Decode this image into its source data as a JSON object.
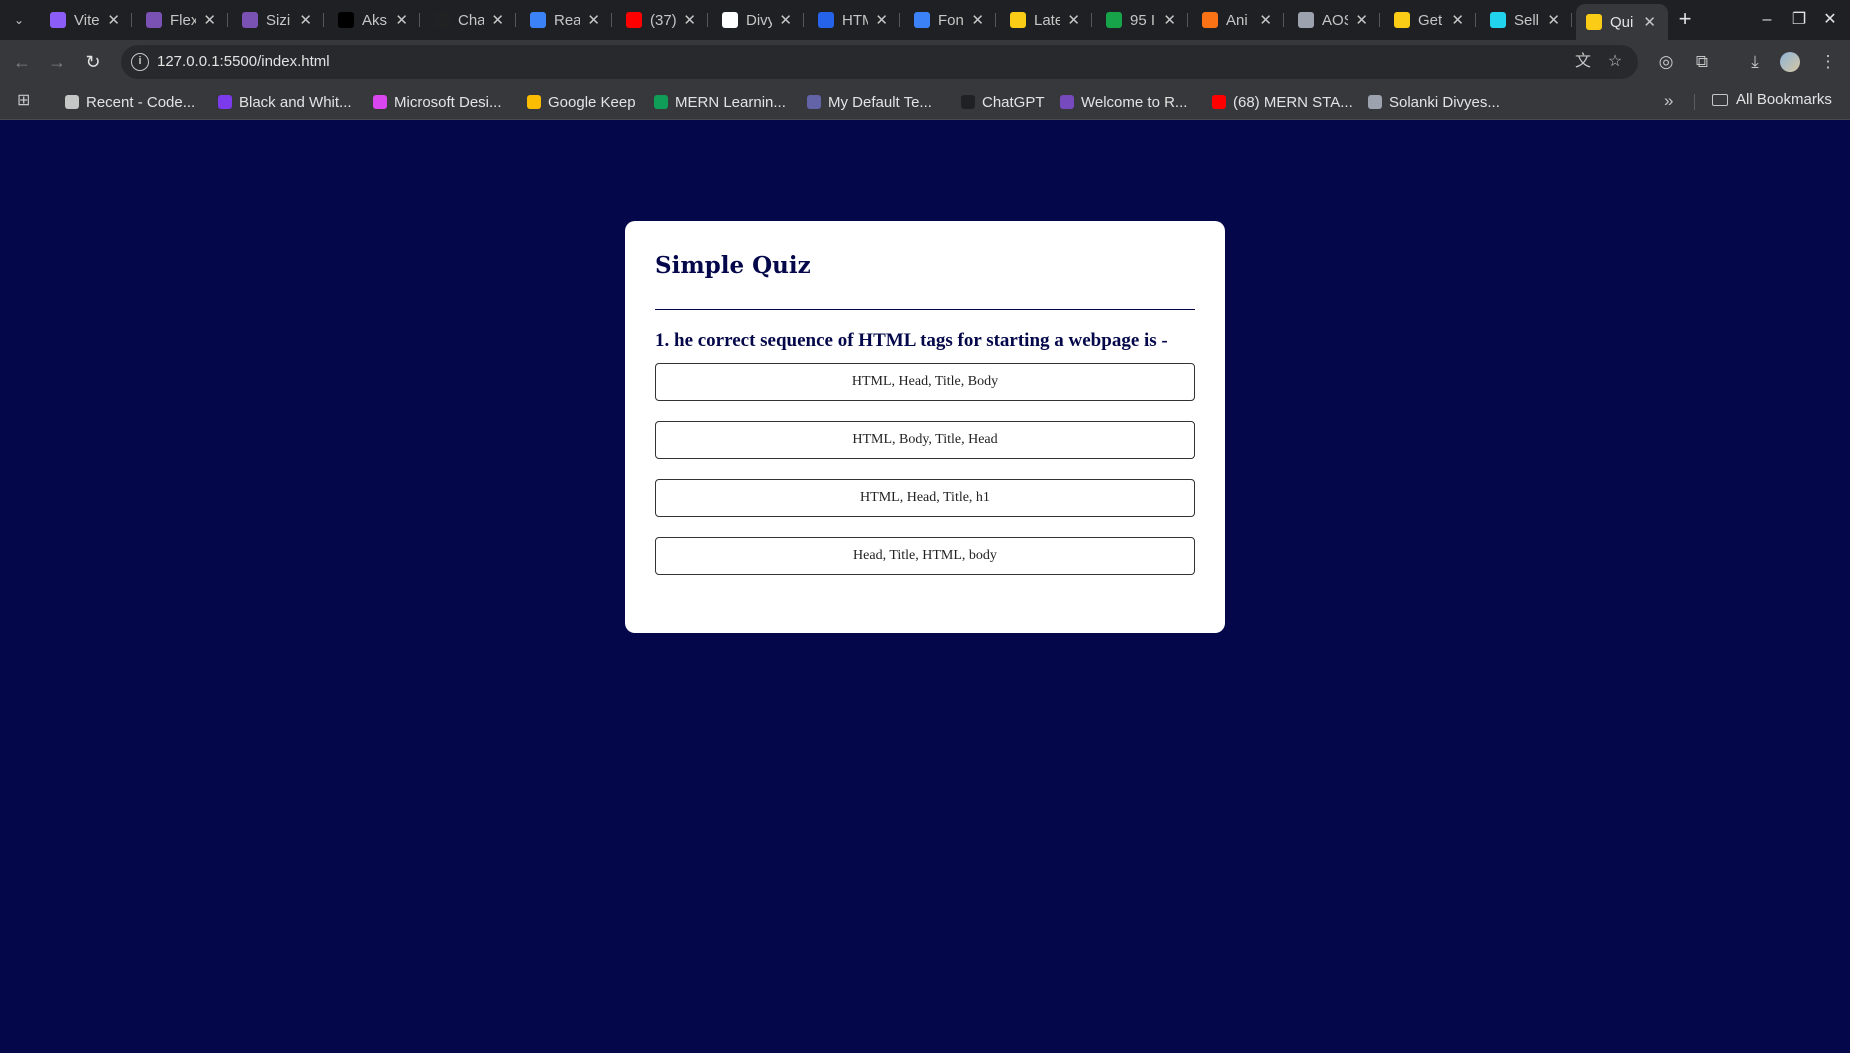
{
  "browser": {
    "tabs": [
      {
        "label": "Vite",
        "icon": "vite-icon",
        "color": "#8b5cf6"
      },
      {
        "label": "Flex",
        "icon": "bootstrap-icon",
        "color": "#7952b3"
      },
      {
        "label": "Sizi",
        "icon": "bootstrap-icon",
        "color": "#7952b3"
      },
      {
        "label": "Aks",
        "icon": "ag-icon",
        "color": "#000000"
      },
      {
        "label": "Cha",
        "icon": "chatgpt-icon",
        "color": "#202123"
      },
      {
        "label": "Rea",
        "icon": "react-icon",
        "color": "#3b82f6"
      },
      {
        "label": "(37)",
        "icon": "youtube-icon",
        "color": "#ff0000"
      },
      {
        "label": "Divy",
        "icon": "github-icon",
        "color": "#ffffff"
      },
      {
        "label": "HTM",
        "icon": "globe-icon",
        "color": "#2563eb"
      },
      {
        "label": "Fon",
        "icon": "flag-icon",
        "color": "#3b82f6"
      },
      {
        "label": "Late",
        "icon": "chat-icon",
        "color": "#facc15"
      },
      {
        "label": "95 I",
        "icon": "page-icon",
        "color": "#16a34a"
      },
      {
        "label": "Ani",
        "icon": "burst-icon",
        "color": "#f97316"
      },
      {
        "label": "AOS",
        "icon": "globe-icon",
        "color": "#9ca3af"
      },
      {
        "label": "Get",
        "icon": "smiley-icon",
        "color": "#facc15"
      },
      {
        "label": "Sell",
        "icon": "phone-icon",
        "color": "#22d3ee"
      },
      {
        "label": "Qui",
        "icon": "quiz-icon",
        "color": "#facc15",
        "active": true
      }
    ],
    "url": "127.0.0.1:5500/index.html",
    "bookmarks": [
      {
        "label": "Recent - Code...",
        "icon": "square-icon",
        "color": "#c4c7c5"
      },
      {
        "label": "Black and Whit...",
        "icon": "canva-icon",
        "color": "#7c3aed"
      },
      {
        "label": "Microsoft Desi...",
        "icon": "designer-icon",
        "color": "#d946ef"
      },
      {
        "label": "Google Keep",
        "icon": "keep-icon",
        "color": "#fbbc04"
      },
      {
        "label": "MERN Learnin...",
        "icon": "sheets-icon",
        "color": "#0f9d58"
      },
      {
        "label": "My Default Te...",
        "icon": "teams-icon",
        "color": "#6264a7"
      },
      {
        "label": "ChatGPT",
        "icon": "chatgpt-icon",
        "color": "#202123"
      },
      {
        "label": "Welcome to R...",
        "icon": "redux-icon",
        "color": "#764abc"
      },
      {
        "label": "(68) MERN STA...",
        "icon": "youtube-icon",
        "color": "#ff0000"
      },
      {
        "label": "Solanki Divyes...",
        "icon": "pin-icon",
        "color": "#9ca3af"
      }
    ],
    "all_bookmarks": "All Bookmarks"
  },
  "quiz": {
    "title": "Simple Quiz",
    "question": "1. he correct sequence of HTML tags for starting a webpage is -",
    "answers": [
      "HTML, Head, Title, Body",
      "HTML, Body, Title, Head",
      "HTML, Head, Title, h1",
      "Head, Title, HTML, body"
    ]
  },
  "colors": {
    "page_background": "#04084a",
    "card_background": "#ffffff",
    "heading": "#04084a"
  }
}
